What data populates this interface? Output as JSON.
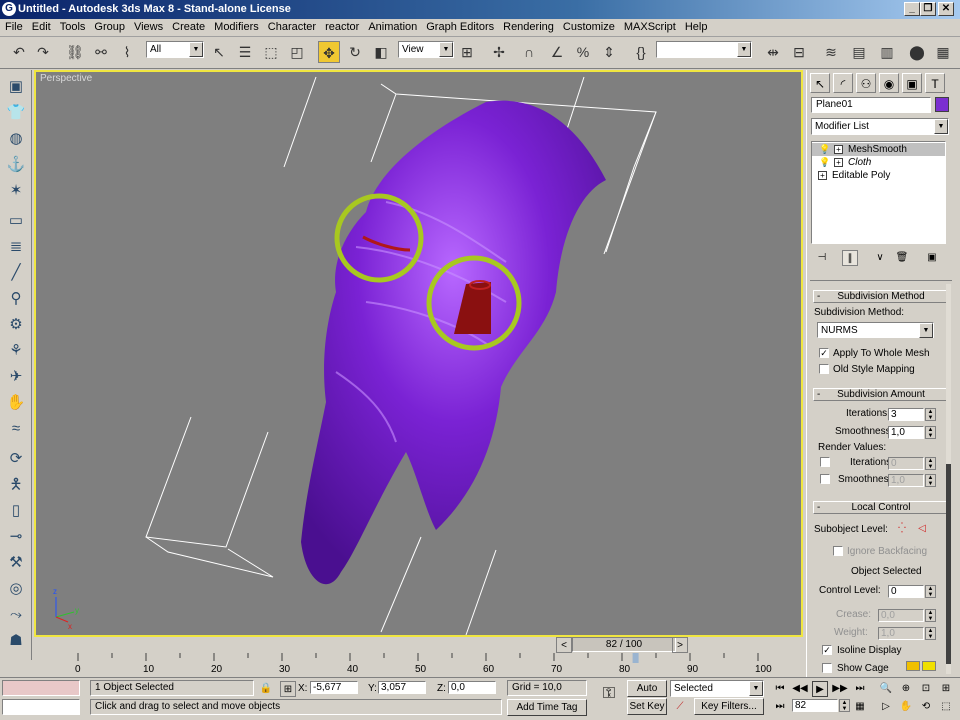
{
  "window": {
    "title": "Untitled - Autodesk 3ds Max 8 - Stand-alone License",
    "app_icon": "3ds-max-icon",
    "buttons": [
      "minimize-icon",
      "restore-icon",
      "close-icon"
    ]
  },
  "menu": {
    "items": [
      "File",
      "Edit",
      "Tools",
      "Group",
      "Views",
      "Create",
      "Modifiers",
      "Character",
      "reactor",
      "Animation",
      "Graph Editors",
      "Rendering",
      "Customize",
      "MAXScript",
      "Help"
    ]
  },
  "toolbar": {
    "selection_filter": "All",
    "ref_coord": "View",
    "named_selection": ""
  },
  "viewport": {
    "label": "Perspective",
    "axis_labels": {
      "z": "z",
      "x": "x",
      "y": "y"
    }
  },
  "command_panel": {
    "object_name": "Plane01",
    "object_color": "#7b2fd0",
    "modifier_list": "Modifier List",
    "stack": [
      {
        "label": "MeshSmooth",
        "selected": true
      },
      {
        "label": "Cloth",
        "selected": false,
        "italic": true
      },
      {
        "label": "Editable Poly",
        "selected": false
      }
    ],
    "subdivision_method": {
      "rollout": "Subdivision Method",
      "label": "Subdivision Method:",
      "value": "NURMS",
      "apply_whole_mesh": "Apply To Whole Mesh",
      "apply_whole_mesh_checked": true,
      "old_style": "Old Style Mapping",
      "old_style_checked": false
    },
    "subdivision_amount": {
      "rollout": "Subdivision Amount",
      "iterations_label": "Iterations:",
      "iterations": "3",
      "smoothness_label": "Smoothness:",
      "smoothness": "1,0",
      "render_values": "Render Values:",
      "render_iterations_label": "Iterations:",
      "render_iterations": "0",
      "render_smoothness_label": "Smoothness:",
      "render_smoothness": "1,0"
    },
    "local_control": {
      "rollout": "Local Control",
      "subobject_label": "Subobject Level:",
      "ignore_backfacing": "Ignore Backfacing",
      "object_selected": "Object Selected",
      "control_level_label": "Control Level:",
      "control_level": "0",
      "crease_label": "Crease:",
      "crease": "0,0",
      "weight_label": "Weight:",
      "weight": "1,0",
      "isoline": "Isoline Display",
      "isoline_checked": true,
      "show_cage": "Show Cage"
    }
  },
  "time": {
    "slider_label": "82 / 100",
    "current_frame": 82,
    "total_frames": 100,
    "track_ticks": [
      "0",
      "10",
      "20",
      "30",
      "40",
      "50",
      "60",
      "70",
      "80",
      "90",
      "100"
    ]
  },
  "status": {
    "selection": "1 Object Selected",
    "prompt": "Click and drag to select and move objects",
    "x_label": "X:",
    "x": "-5,677",
    "y_label": "Y:",
    "y": "3,057",
    "z_label": "Z:",
    "z": "0,0",
    "grid": "Grid = 10,0",
    "add_time_tag": "Add Time Tag",
    "auto_key": "Auto Key",
    "set_key": "Set Key",
    "key_mode": "Selected",
    "key_filters": "Key Filters...",
    "frame": "82"
  },
  "colors": {
    "highlight_circle": "#a8c820",
    "cloth_purple": "#7020c0",
    "viewport_bg": "#7f7f7f",
    "active_border": "#f0e640"
  }
}
